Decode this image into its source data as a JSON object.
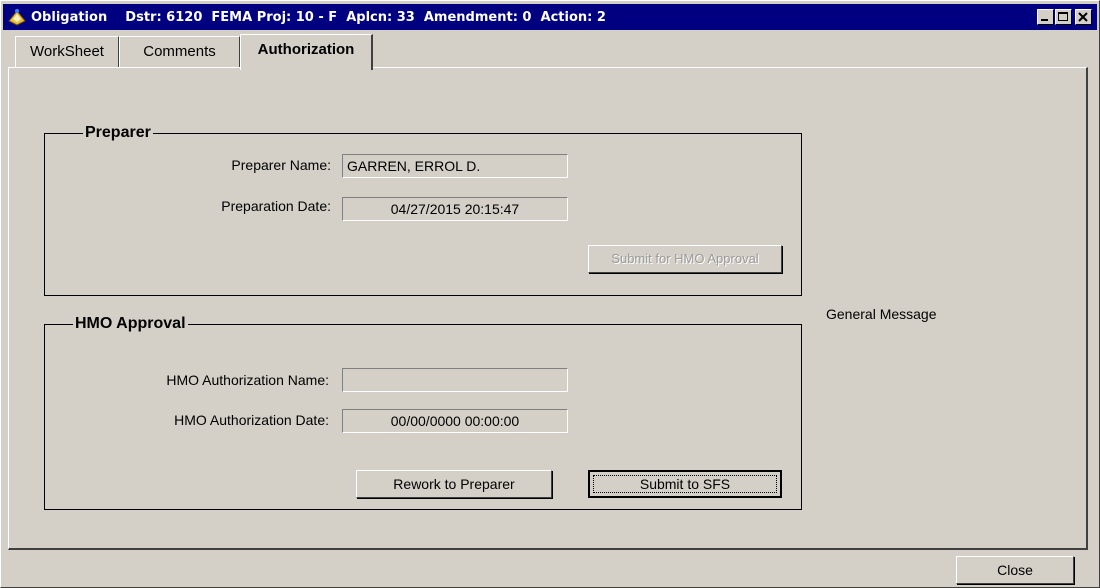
{
  "window": {
    "title": "Obligation    Dstr: 6120  FEMA Proj: 10 - F  Aplcn: 33  Amendment: 0  Action: 2",
    "app_icon": "obligation-app-icon",
    "buttons": {
      "minimize": "minimize-icon",
      "maximize": "maximize-icon",
      "close": "close-icon"
    }
  },
  "tabs": [
    {
      "label": "WorkSheet",
      "active": false
    },
    {
      "label": "Comments",
      "active": false
    },
    {
      "label": "Authorization",
      "active": true
    }
  ],
  "preparer": {
    "group_title": "Preparer",
    "name_label": "Preparer Name:",
    "name_value": "GARREN, ERROL D.",
    "date_label": "Preparation Date:",
    "date_value": "04/27/2015 20:15:47",
    "submit_button": "Submit for HMO Approval"
  },
  "hmo": {
    "group_title": "HMO Approval",
    "name_label": "HMO Authorization Name:",
    "name_value": "",
    "date_label": "HMO Authorization Date:",
    "date_value": "00/00/0000 00:00:00",
    "rework_button": "Rework to Preparer",
    "submit_button": "Submit to SFS"
  },
  "general_message": "General Message",
  "close_button": "Close",
  "colors": {
    "titlebar": "#000080",
    "face": "#d4d0c8"
  }
}
